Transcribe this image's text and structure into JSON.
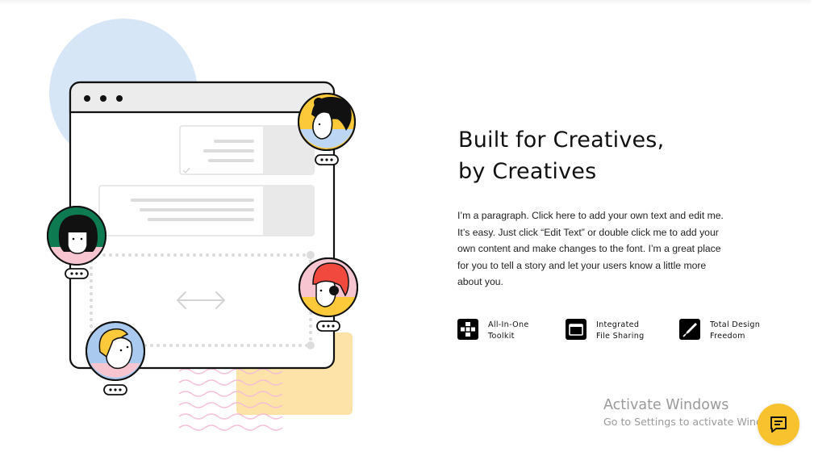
{
  "section": {
    "heading_line1": "Built for Creatives,",
    "heading_line2": "by Creatives",
    "paragraph": "I’m a paragraph. Click here to add your own text and edit me. It’s easy. Just click “Edit Text” or double click me to add your own content and make changes to the font. I’m a great place for you to tell a story and let your users know a little more about you."
  },
  "features": [
    {
      "icon": "grid-icon",
      "line1": "All-In-One",
      "line2": "Toolkit"
    },
    {
      "icon": "folder-icon",
      "line1": "Integrated",
      "line2": "File Sharing"
    },
    {
      "icon": "pen-icon",
      "line1": "Total Design",
      "line2": "Freedom"
    }
  ],
  "watermark": {
    "title": "Activate Windows",
    "subtitle": "Go to Settings to activate Windows."
  },
  "chat": {
    "icon": "chat-icon"
  },
  "colors": {
    "accent_yellow": "#f8c22e",
    "light_blue": "#d6e6f7",
    "avatar_green": "#0e7a52",
    "avatar_pink": "#f6c5cf",
    "avatar_blue": "#a9c9ee",
    "soft_yellow": "#fde3a7",
    "wave_pink": "#f4bcd6"
  }
}
